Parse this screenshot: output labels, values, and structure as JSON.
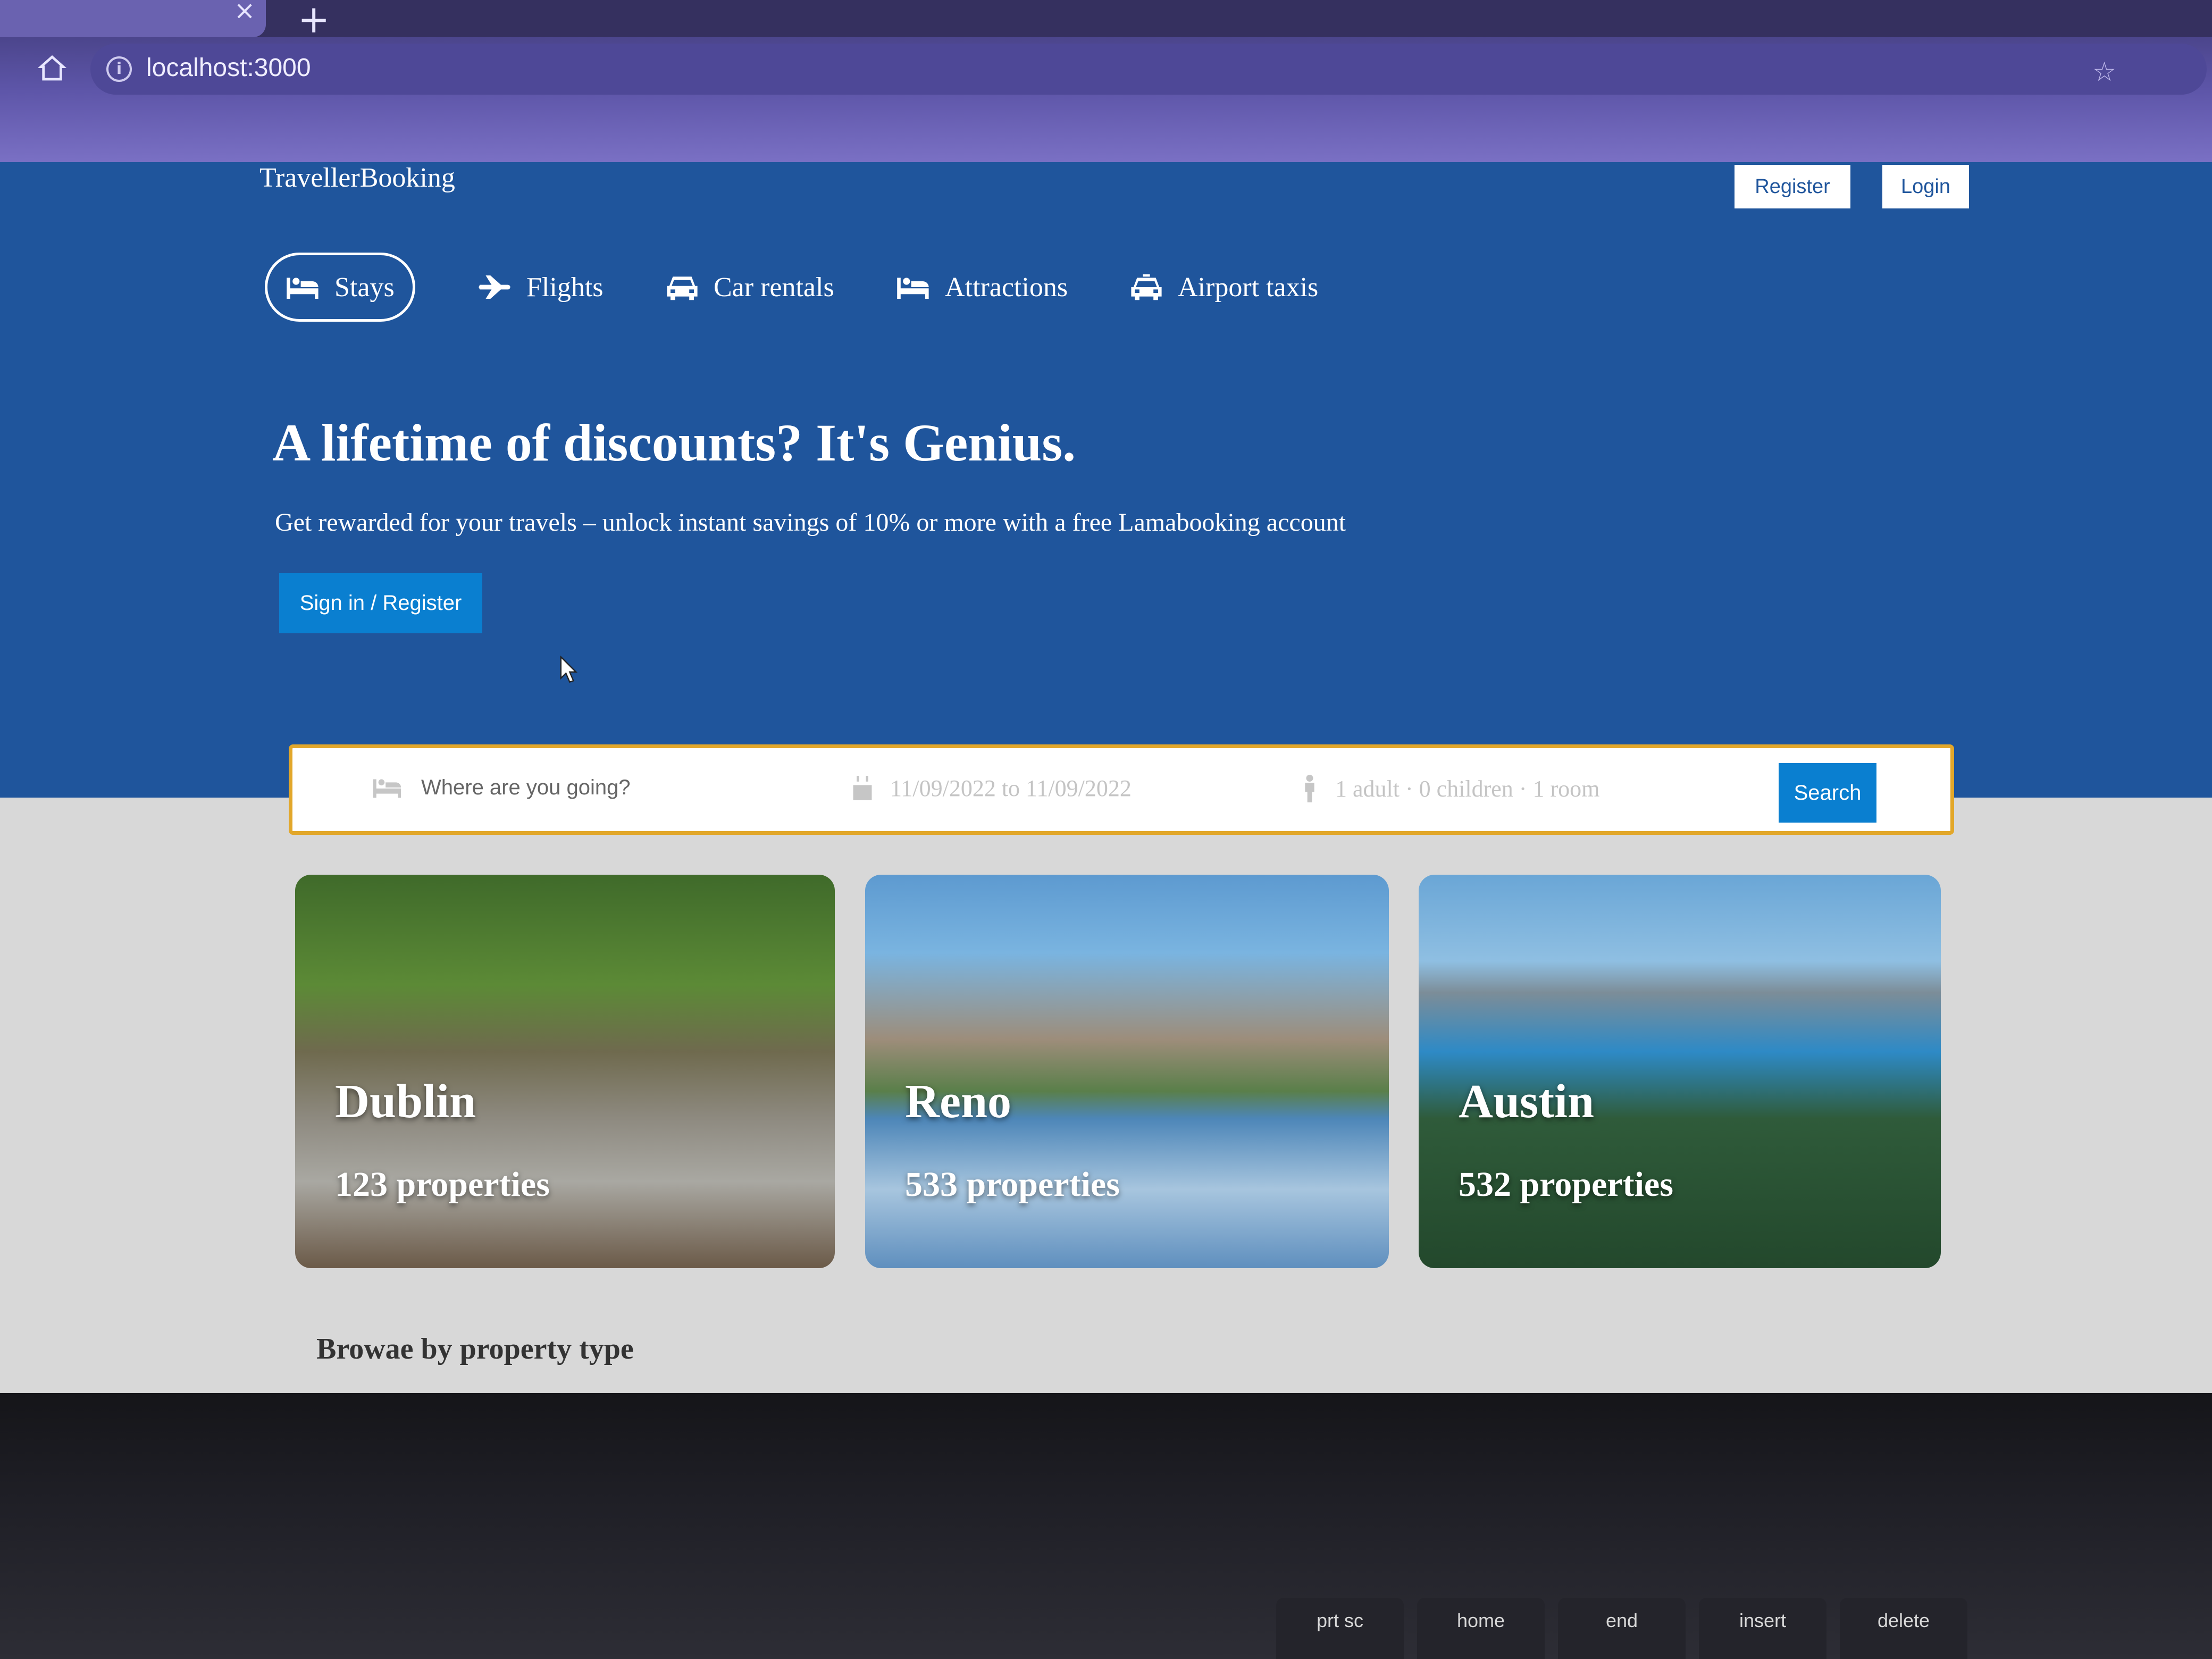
{
  "browser": {
    "new_tab": "+",
    "tab_close": "×",
    "url": "localhost:3000"
  },
  "header": {
    "logo": "TravellerBooking",
    "register": "Register",
    "login": "Login"
  },
  "nav": {
    "items": [
      {
        "label": "Stays",
        "icon": "bed-icon",
        "active": true
      },
      {
        "label": "Flights",
        "icon": "plane-icon"
      },
      {
        "label": "Car rentals",
        "icon": "car-icon"
      },
      {
        "label": "Attractions",
        "icon": "bed-icon"
      },
      {
        "label": "Airport taxis",
        "icon": "taxi-icon"
      }
    ]
  },
  "hero": {
    "title": "A lifetime of discounts? It's Genius.",
    "subtitle": "Get rewarded for your travels – unlock instant savings of 10% or more with a free Lamabooking account",
    "button": "Sign in / Register"
  },
  "search": {
    "placeholder": "Where are you going?",
    "dates": "11/09/2022 to 11/09/2022",
    "options": "1 adult · 0 children · 1 room",
    "button": "Search"
  },
  "featured": [
    {
      "name": "Dublin",
      "count": "123 properties"
    },
    {
      "name": "Reno",
      "count": "533 properties"
    },
    {
      "name": "Austin",
      "count": "532 properties"
    }
  ],
  "section": {
    "title": "Browae by property type"
  },
  "keyboard": [
    "prt sc",
    "home",
    "end",
    "insert",
    "delete"
  ],
  "colors": {
    "header_bg": "#1f559c",
    "accent_blue": "#0a7fd0",
    "searchbar_border": "#e2a72a",
    "browser_chrome": "#5d55a8"
  }
}
